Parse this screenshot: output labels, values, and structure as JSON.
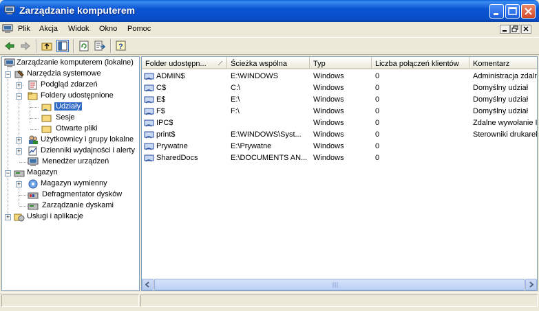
{
  "window": {
    "title": "Zarządzanie komputerem"
  },
  "menu": {
    "items": [
      "Plik",
      "Akcja",
      "Widok",
      "Okno",
      "Pomoc"
    ]
  },
  "toolbar": {
    "icons": [
      "back-arrow-icon",
      "forward-arrow-icon",
      "up-folder-icon",
      "show-hide-tree-icon",
      "refresh-icon",
      "export-list-icon",
      "help-icon"
    ]
  },
  "tree": {
    "root": "Zarządzanie komputerem (lokalne)",
    "items": [
      {
        "label": "Narzędzia systemowe",
        "expanded": true
      },
      {
        "label": "Podgląd zdarzeń",
        "expanded": false
      },
      {
        "label": "Foldery udostępnione",
        "expanded": true
      },
      {
        "label": "Udziały",
        "selected": true
      },
      {
        "label": "Sesje"
      },
      {
        "label": "Otwarte pliki"
      },
      {
        "label": "Użytkownicy i grupy lokalne",
        "expanded": false
      },
      {
        "label": "Dzienniki wydajności i alerty",
        "expanded": false
      },
      {
        "label": "Menedżer urządzeń"
      },
      {
        "label": "Magazyn",
        "expanded": true
      },
      {
        "label": "Magazyn wymienny",
        "expanded": false
      },
      {
        "label": "Defragmentator dysków"
      },
      {
        "label": "Zarządzanie dyskami"
      },
      {
        "label": "Usługi i aplikacje",
        "expanded": false
      }
    ]
  },
  "list": {
    "columns": [
      "Folder udostępn...",
      "Ścieżka wspólna",
      "Typ",
      "Liczba połączeń klientów",
      "Komentarz"
    ],
    "rows": [
      {
        "folder": "ADMIN$",
        "path": "E:\\WINDOWS",
        "type": "Windows",
        "connections": "0",
        "comment": "Administracja zdalna"
      },
      {
        "folder": "C$",
        "path": "C:\\",
        "type": "Windows",
        "connections": "0",
        "comment": "Domyślny udział"
      },
      {
        "folder": "E$",
        "path": "E:\\",
        "type": "Windows",
        "connections": "0",
        "comment": "Domyślny udział"
      },
      {
        "folder": "F$",
        "path": "F:\\",
        "type": "Windows",
        "connections": "0",
        "comment": "Domyślny udział"
      },
      {
        "folder": "IPC$",
        "path": "",
        "type": "Windows",
        "connections": "0",
        "comment": "Zdalne wywołanie IPC"
      },
      {
        "folder": "print$",
        "path": "E:\\WINDOWS\\Syst...",
        "type": "Windows",
        "connections": "0",
        "comment": "Sterowniki drukarek"
      },
      {
        "folder": "Prywatne",
        "path": "E:\\Prywatne",
        "type": "Windows",
        "connections": "0",
        "comment": ""
      },
      {
        "folder": "SharedDocs",
        "path": "E:\\DOCUMENTS AN...",
        "type": "Windows",
        "connections": "0",
        "comment": ""
      }
    ]
  }
}
